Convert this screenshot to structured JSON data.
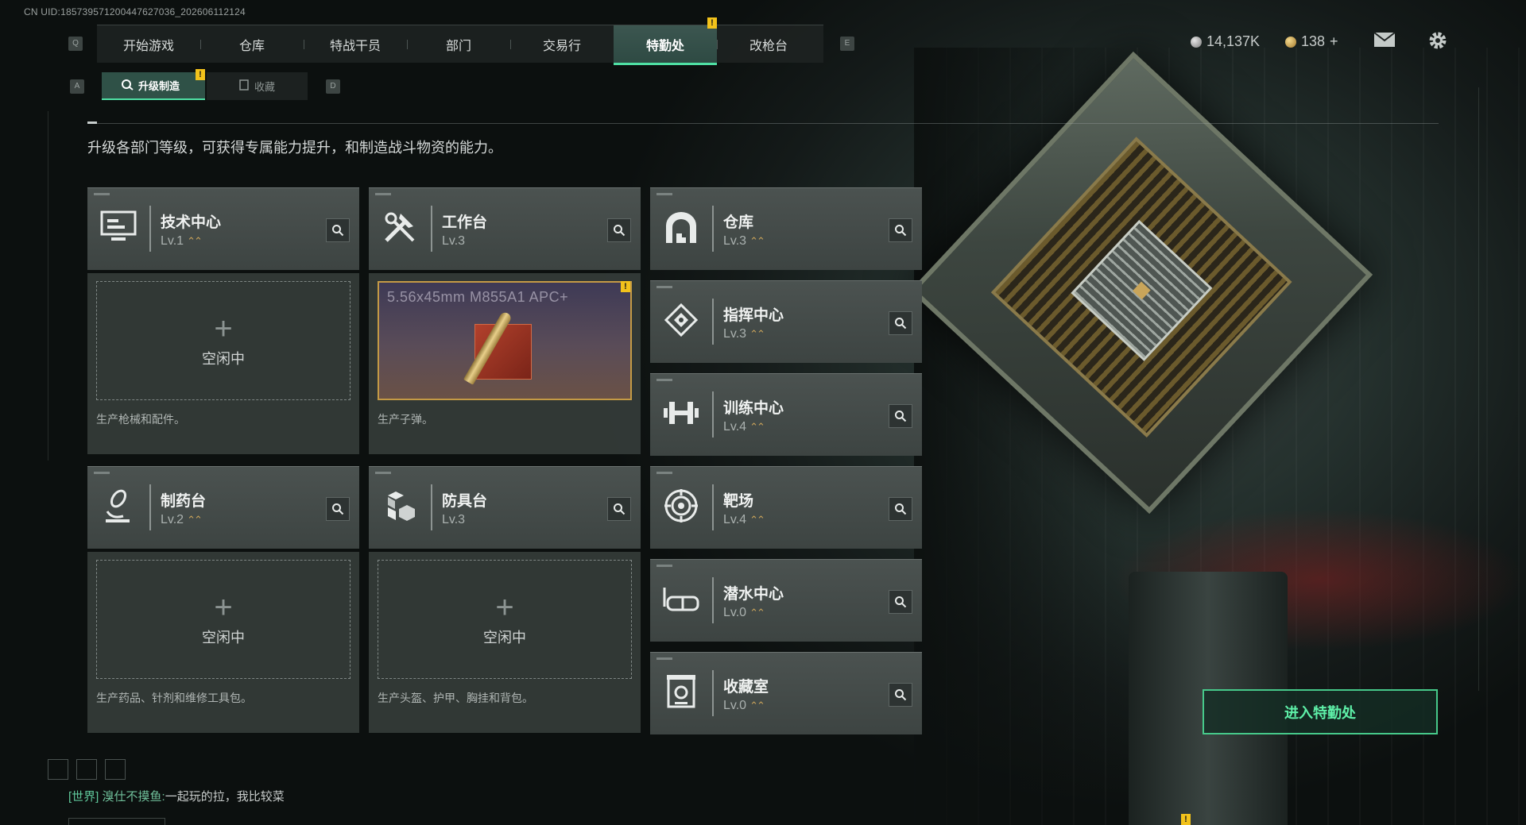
{
  "uid": "CN UID:1857395712004476270­36_202606112124",
  "nav": {
    "prev_key": "Q",
    "next_key": "E",
    "tabs": [
      {
        "label": "开始游戏",
        "active": false
      },
      {
        "label": "仓库",
        "active": false
      },
      {
        "label": "特战干员",
        "active": false
      },
      {
        "label": "部门",
        "active": false
      },
      {
        "label": "交易行",
        "active": false
      },
      {
        "label": "特勤处",
        "active": true,
        "alert": "!"
      },
      {
        "label": "改枪台",
        "active": false
      }
    ]
  },
  "resources": {
    "silver": "14,137K",
    "gold": "138",
    "gold_add": "+"
  },
  "subtabs": {
    "prev_key": "A",
    "next_key": "D",
    "items": [
      {
        "label": "升级制造",
        "active": true,
        "alert": "!"
      },
      {
        "label": "收藏",
        "active": false
      }
    ]
  },
  "description": "升级各部门等级，可获得专属能力提升，和制造战斗物资的能力。",
  "facilities": [
    {
      "name": "技术中心",
      "level": "Lv.1",
      "icon": "computer-icon"
    },
    {
      "name": "工作台",
      "level": "Lv.3",
      "icon": "tools-icon"
    },
    {
      "name": "仓库",
      "level": "Lv.3",
      "icon": "warehouse-icon"
    },
    {
      "name": "指挥中心",
      "level": "Lv.3",
      "icon": "command-icon"
    },
    {
      "name": "训练中心",
      "level": "Lv.4",
      "icon": "dumbbell-icon"
    },
    {
      "name": "制药台",
      "level": "Lv.2",
      "icon": "microscope-icon"
    },
    {
      "name": "防具台",
      "level": "Lv.3",
      "icon": "armor-cubes-icon"
    },
    {
      "name": "靶场",
      "level": "Lv.4",
      "icon": "target-icon"
    },
    {
      "name": "潜水中心",
      "level": "Lv.0",
      "icon": "diving-mask-icon"
    },
    {
      "name": "收藏室",
      "level": "Lv.0",
      "icon": "collection-icon"
    }
  ],
  "production": {
    "tech": {
      "idle": "空闲中",
      "desc": "生产枪械和配件。"
    },
    "workbench": {
      "item": "5.56x45mm M855A1 APC+",
      "desc": "生产子弹。",
      "alert": "!"
    },
    "pharmacy": {
      "idle": "空闲中",
      "desc": "生产药品、针剂和维修工具包。"
    },
    "armor": {
      "idle": "空闲中",
      "desc": "生产头盔、护甲、胸挂和背包。"
    }
  },
  "enter_button": "进入特勤处",
  "chat": {
    "channel": "[世界]",
    "nickname": "溴仕不摸鱼:",
    "message": "一起玩的拉，我比较菜"
  },
  "colors": {
    "accent": "#4fe0a4",
    "alert": "#f2c21b",
    "upgrade": "#c9a35a"
  }
}
